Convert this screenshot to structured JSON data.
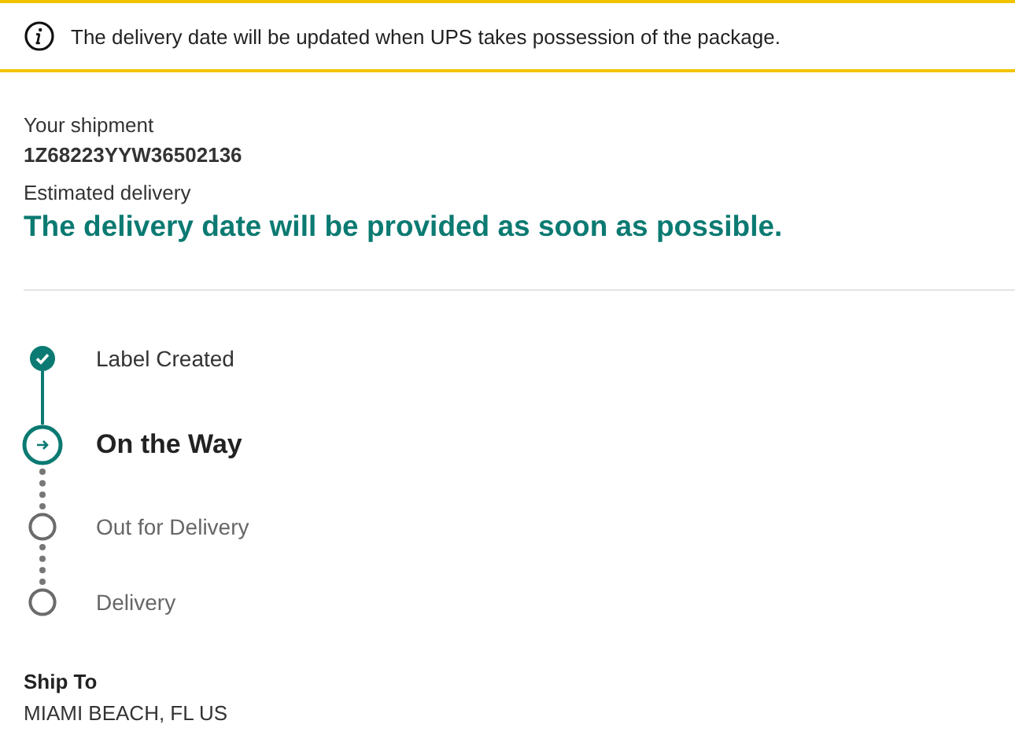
{
  "notice": {
    "text": "The delivery date will be updated when UPS takes possession of the package."
  },
  "shipment": {
    "label": "Your shipment",
    "tracking_number": "1Z68223YYW36502136",
    "estimate_label": "Estimated delivery",
    "estimate": "The delivery date will be provided as soon as possible."
  },
  "steps": [
    {
      "label": "Label Created",
      "kind": "done"
    },
    {
      "label": "On the Way",
      "kind": "current"
    },
    {
      "label": "Out for Delivery",
      "kind": "pending"
    },
    {
      "label": "Delivery",
      "kind": "pending"
    }
  ],
  "ship_to": {
    "label": "Ship To",
    "value": "MIAMI BEACH, FL US"
  }
}
